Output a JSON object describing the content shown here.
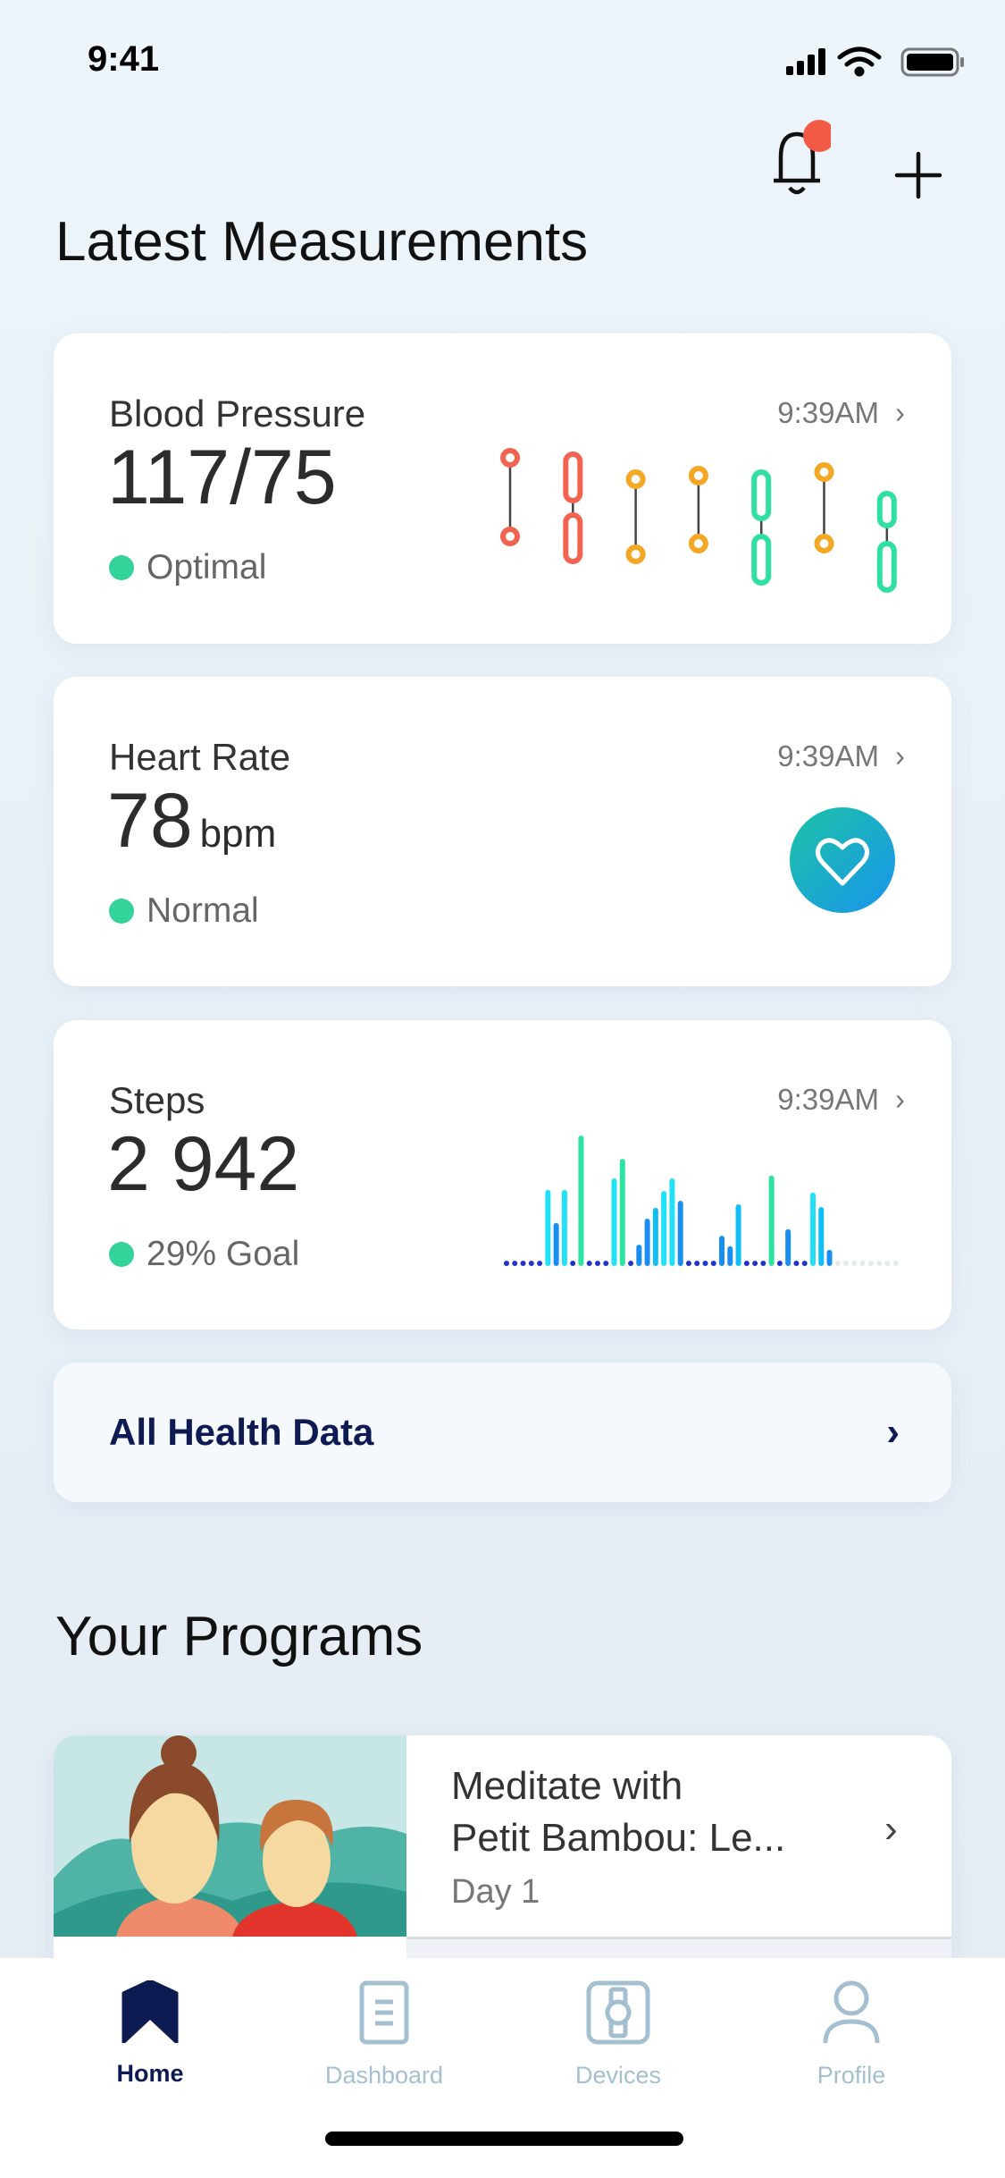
{
  "status": {
    "time": "9:41"
  },
  "header": {
    "title": "Latest Measurements",
    "notification_badge": true,
    "icons": [
      "bell-icon",
      "plus-icon"
    ]
  },
  "cards": [
    {
      "title": "Blood Pressure",
      "value": "117/75",
      "unit": "",
      "status": "Optimal",
      "time": "9:39AM",
      "chevron": "›"
    },
    {
      "title": "Heart Rate",
      "value": "78",
      "unit": "bpm",
      "status": "Normal",
      "time": "9:39AM",
      "chevron": "›"
    },
    {
      "title": "Steps",
      "value": "2 942",
      "unit": "",
      "status": "29% Goal",
      "time": "9:39AM",
      "chevron": "›"
    }
  ],
  "all_health": {
    "label": "All Health Data",
    "chevron": "›"
  },
  "programs": {
    "title": "Your Programs",
    "items": [
      {
        "title_line1": "Meditate with",
        "title_line2": "Petit Bambou: Le...",
        "subtitle": "Day 1",
        "chevron": "›"
      }
    ]
  },
  "tabs": [
    {
      "label": "Home",
      "active": true
    },
    {
      "label": "Dashboard"
    },
    {
      "label": "Devices"
    },
    {
      "label": "Profile"
    }
  ],
  "colors": {
    "navy": "#0d1b52",
    "status_green": "#34d399",
    "red": "#f26450",
    "orange": "#f5a623",
    "green": "#2fe0a2",
    "tab_inactive": "#a4c0d0"
  },
  "chart_data": [
    {
      "type": "range",
      "readings": [
        {
          "sys": [
            147,
            147
          ],
          "dia": [
            125,
            125
          ],
          "color": "red"
        },
        {
          "sys": [
            137,
            146
          ],
          "dia": [
            120,
            129
          ],
          "color": "red"
        },
        {
          "sys": [
            141,
            141
          ],
          "dia": [
            120,
            120
          ],
          "color": "orange"
        },
        {
          "sys": [
            142,
            142
          ],
          "dia": [
            123,
            123
          ],
          "color": "orange"
        },
        {
          "sys": [
            132,
            141
          ],
          "dia": [
            114,
            123
          ],
          "color": "green"
        },
        {
          "sys": [
            143,
            143
          ],
          "dia": [
            123,
            123
          ],
          "color": "orange"
        },
        {
          "sys": [
            130,
            135
          ],
          "dia": [
            112,
            121
          ],
          "color": "green"
        }
      ]
    },
    {
      "type": "bar",
      "slots": 48,
      "future_from": 40,
      "bars": [
        [
          5,
          182,
          "cyan"
        ],
        [
          6,
          97,
          "blue"
        ],
        [
          7,
          182,
          "cyan"
        ],
        [
          9,
          322,
          "green"
        ],
        [
          13,
          212,
          "cyan"
        ],
        [
          14,
          262,
          "green"
        ],
        [
          16,
          41,
          "blue"
        ],
        [
          17,
          108,
          "blue"
        ],
        [
          18,
          136,
          "sky"
        ],
        [
          19,
          179,
          "cyan"
        ],
        [
          20,
          212,
          "cyan"
        ],
        [
          21,
          154,
          "blue"
        ],
        [
          26,
          64,
          "blue"
        ],
        [
          27,
          37,
          "blue"
        ],
        [
          28,
          145,
          "sky"
        ],
        [
          32,
          219,
          "green"
        ],
        [
          34,
          81,
          "blue"
        ],
        [
          37,
          175,
          "cyan"
        ],
        [
          38,
          138,
          "sky"
        ],
        [
          39,
          28,
          "blue"
        ]
      ]
    }
  ]
}
